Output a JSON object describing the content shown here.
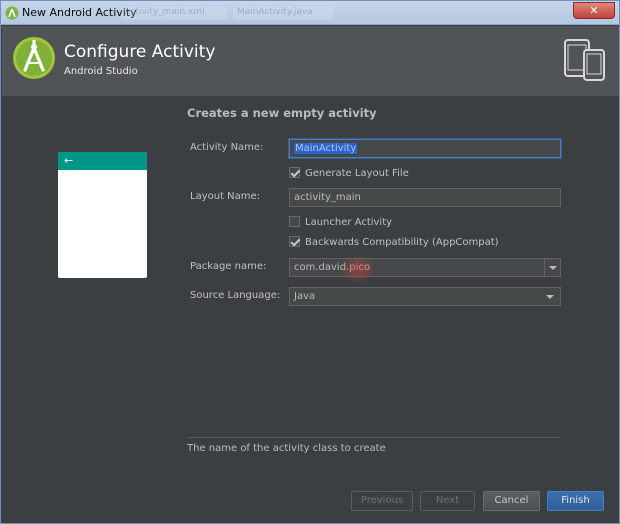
{
  "window": {
    "title": "New Android Activity",
    "background_tabs": [
      "activity_main.xml",
      "MainActivity.java"
    ],
    "close_label": "✕"
  },
  "header": {
    "title": "Configure Activity",
    "subtitle": "Android Studio"
  },
  "section_title": "Creates a new empty activity",
  "preview": {
    "back_icon": "←"
  },
  "form": {
    "activity_name_label": "Activity Name:",
    "activity_name_value": "MainActivity",
    "generate_layout_label": "Generate Layout File",
    "generate_layout_checked": true,
    "layout_name_label": "Layout Name:",
    "layout_name_value": "activity_main",
    "launcher_activity_label": "Launcher Activity",
    "launcher_activity_checked": false,
    "backwards_compat_label": "Backwards Compatibility (AppCompat)",
    "backwards_compat_checked": true,
    "package_name_label": "Package name:",
    "package_name_value": "com.david.pico",
    "source_language_label": "Source Language:",
    "source_language_value": "Java"
  },
  "hint": "The name of the activity class to create",
  "buttons": {
    "previous": "Previous",
    "next": "Next",
    "cancel": "Cancel",
    "finish": "Finish"
  },
  "colors": {
    "accent_teal": "#009688",
    "android_green": "#a4c639",
    "finish_blue": "#2f5e98",
    "selection_blue": "#2f65ca"
  }
}
